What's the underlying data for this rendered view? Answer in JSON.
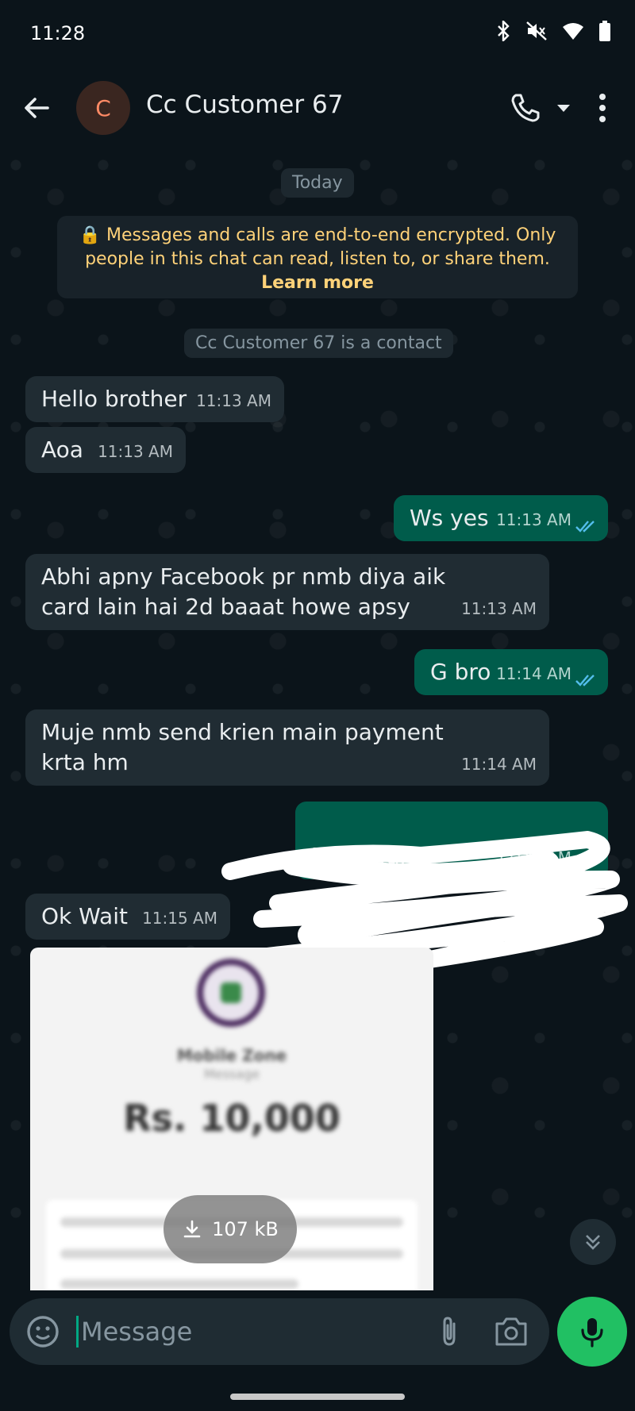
{
  "status_bar": {
    "time": "11:28",
    "icons": [
      "bluetooth-icon",
      "mute-icon",
      "wifi-icon",
      "battery-icon"
    ]
  },
  "header": {
    "avatar_letter": "C",
    "contact_name": "Cc Customer 67",
    "icons": [
      "back-arrow-icon",
      "phone-icon",
      "chevron-down-icon",
      "more-vert-icon"
    ]
  },
  "chat": {
    "date_pill": "Today",
    "encryption": {
      "text": "Messages and calls are end-to-end encrypted. Only people in this chat can read, listen to, or share them.",
      "link": "Learn more"
    },
    "contact_notice": "Cc Customer 67 is a contact",
    "messages": [
      {
        "direction": "in",
        "text": "Hello brother",
        "time": "11:13 AM"
      },
      {
        "direction": "in",
        "text": "Aoa",
        "time": "11:13 AM"
      },
      {
        "direction": "out",
        "text": "Ws yes",
        "time": "11:13 AM"
      },
      {
        "direction": "in",
        "text": "Abhi apny Facebook pr nmb diya aik card lain hai 2d baaat howe apsy",
        "time": "11:13 AM"
      },
      {
        "direction": "out",
        "text": "G bro",
        "time": "11:14 AM"
      },
      {
        "direction": "in",
        "text": "Muje nmb send krien main payment krta hm",
        "time": "11:14 AM"
      },
      {
        "direction": "out",
        "text": "M   an bank",
        "time": "11:14 AM"
      },
      {
        "direction": "in",
        "text": "Ok Wait",
        "time": "11:15 AM"
      }
    ],
    "image_message": {
      "shop_name": "Mobile Zone",
      "shop_sub": "Message",
      "amount": "Rs. 10,000",
      "download_size": "107 kB"
    }
  },
  "composer": {
    "placeholder": "Message"
  },
  "colors": {
    "incoming": "#202c33",
    "outgoing": "#005c4b",
    "accent": "#21c063",
    "background": "#0b141a",
    "encryption_text": "#ffd279"
  }
}
